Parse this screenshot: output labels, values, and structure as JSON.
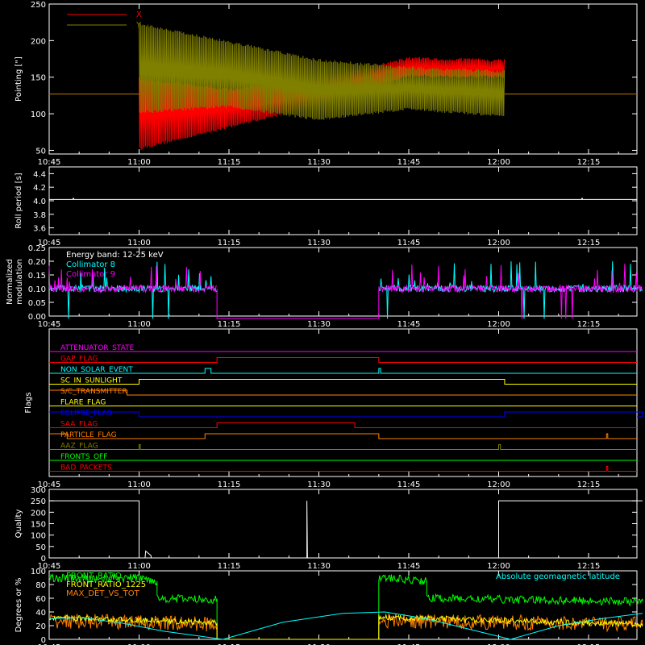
{
  "time_ticks": [
    "10:45",
    "11:00",
    "11:15",
    "11:30",
    "11:45",
    "12:00",
    "12:15"
  ],
  "colors": {
    "x": "#ff0000",
    "y": "#808000",
    "white": "#ffffff",
    "cyan": "#00ffff",
    "magenta": "#ff00ff",
    "green": "#00ff00",
    "orange": "#ff8000"
  },
  "chart_data": [
    {
      "type": "line",
      "ylabel": "Pointing [\"]",
      "ylim": [
        45,
        250
      ],
      "yticks": [
        "50",
        "100",
        "150",
        "200",
        "250"
      ],
      "legend": [
        "X",
        "Y"
      ],
      "series": [
        {
          "name": "X",
          "color": "#ff0000",
          "baseline": 127,
          "active_start": "11:00",
          "active_end": "12:01",
          "envelope_time": [
            "11:00",
            "11:15",
            "11:30",
            "11:45",
            "12:00"
          ],
          "envelope_low": [
            50,
            80,
            110,
            150,
            148
          ],
          "envelope_high": [
            150,
            135,
            150,
            178,
            175
          ]
        },
        {
          "name": "Y",
          "color": "#808000",
          "baseline": 127,
          "active_start": "11:00",
          "active_end": "12:01",
          "envelope_time": [
            "11:00",
            "11:15",
            "11:30",
            "11:45",
            "12:00"
          ],
          "envelope_low": [
            100,
            108,
            90,
            105,
            95
          ],
          "envelope_high": [
            225,
            200,
            175,
            165,
            160
          ]
        }
      ]
    },
    {
      "type": "line",
      "ylabel": "Roll period [s]",
      "ylim": [
        3.5,
        4.5
      ],
      "yticks": [
        "3.6",
        "3.8",
        "4.0",
        "4.2",
        "4.4"
      ],
      "series": [
        {
          "color": "#ffffff",
          "value": 4.02
        }
      ]
    },
    {
      "type": "line",
      "ylabel": "Normalized modulation",
      "ylim": [
        0,
        0.25
      ],
      "yticks": [
        "0.00",
        "0.05",
        "0.10",
        "0.15",
        "0.20",
        "0.25"
      ],
      "legend": [
        "Energy band: 12-25 keV",
        "Collimator 8",
        "Collimator 9"
      ],
      "series": [
        {
          "name": "Collimator 8",
          "color": "#00ffff",
          "segments": [
            [
              "10:45",
              "11:13"
            ],
            [
              "11:40",
              "12:24"
            ]
          ],
          "mean": 0.1
        },
        {
          "name": "Collimator 9",
          "color": "#ff00ff",
          "segments": [
            [
              "10:45",
              "11:13"
            ],
            [
              "11:40",
              "12:24"
            ]
          ],
          "mean": 0.1,
          "gap_value": -0.01
        }
      ]
    },
    {
      "type": "line",
      "ylabel": "Flags",
      "flags": [
        {
          "name": "ATTENUATOR_STATE",
          "color": "#ff00ff",
          "highs": []
        },
        {
          "name": "GAP_FLAG",
          "color": "#ff0000",
          "highs": [
            [
              "11:13",
              "11:40"
            ]
          ]
        },
        {
          "name": "NON_SOLAR_EVENT",
          "color": "#00ffff",
          "highs": [
            [
              "11:11",
              "11:12"
            ],
            [
              "11:40",
              "11:40.3"
            ]
          ]
        },
        {
          "name": "SC_IN_SUNLIGHT",
          "color": "#ffff00",
          "highs": [
            [
              "11:00",
              "12:01"
            ]
          ]
        },
        {
          "name": "S/C_TRANSMITTER",
          "color": "#ff8000",
          "highs": [
            [
              "10:45",
              "10:58"
            ]
          ]
        },
        {
          "name": "FLARE_FLAG",
          "color": "#ffff00",
          "highs": []
        },
        {
          "name": "ECLIPSE_FLAG",
          "color": "#0000ff",
          "highs": [
            [
              "10:45",
              "11:00"
            ],
            [
              "12:01",
              "12:24"
            ]
          ]
        },
        {
          "name": "SAA_FLAG",
          "color": "#ff0000",
          "highs": [
            [
              "11:13",
              "11:36"
            ]
          ]
        },
        {
          "name": "PARTICLE_FLAG",
          "color": "#ff8000",
          "highs": [
            [
              "10:45",
              "10:48"
            ],
            [
              "11:11",
              "11:40"
            ],
            [
              "12:18",
              "12:18.2"
            ]
          ]
        },
        {
          "name": "AAZ_FLAG",
          "color": "#808000",
          "highs": [
            [
              "11:00",
              "11:00.2"
            ],
            [
              "12:00",
              "12:00.3"
            ]
          ]
        },
        {
          "name": "FRONTS_OFF",
          "color": "#00ff00",
          "highs": []
        },
        {
          "name": "BAD_PACKETS",
          "color": "#ff0000",
          "highs": [
            [
              "12:18",
              "12:18.2"
            ]
          ]
        }
      ]
    },
    {
      "type": "line",
      "ylabel": "Quality",
      "ylim": [
        0,
        300
      ],
      "yticks": [
        "0",
        "50",
        "100",
        "150",
        "200",
        "250",
        "300"
      ],
      "series": [
        {
          "color": "#ffffff",
          "points": [
            [
              "10:45",
              250
            ],
            [
              "11:00",
              250
            ],
            [
              "11:00",
              0
            ],
            [
              "11:01",
              0
            ],
            [
              "11:01.1",
              30
            ],
            [
              "11:02",
              10
            ],
            [
              "11:02",
              0
            ],
            [
              "11:28",
              0
            ],
            [
              "11:28",
              250
            ],
            [
              "11:28.1",
              0
            ],
            [
              "12:00",
              0
            ],
            [
              "12:00",
              250
            ],
            [
              "12:24",
              250
            ]
          ]
        }
      ]
    },
    {
      "type": "line",
      "ylabel": "Degrees or %",
      "ylim": [
        0,
        100
      ],
      "yticks": [
        "0",
        "20",
        "40",
        "60",
        "80",
        "100"
      ],
      "legend": [
        "FRONT_RATIO",
        "FRONT_RATIO_1225",
        "MAX_DET_VS_TOT",
        "Absolute geomagnetic latitude"
      ],
      "series": [
        {
          "name": "FRONT_RATIO",
          "color": "#00ff00",
          "points": [
            [
              "10:45",
              90
            ],
            [
              "10:52",
              88
            ],
            [
              "11:00",
              90
            ],
            [
              "11:03",
              85
            ],
            [
              "11:03",
              60
            ],
            [
              "11:13",
              58
            ],
            [
              "11:13",
              0
            ],
            [
              "11:40",
              0
            ],
            [
              "11:40",
              90
            ],
            [
              "11:48",
              85
            ],
            [
              "11:48",
              60
            ],
            [
              "12:24",
              55
            ]
          ]
        },
        {
          "name": "MAX_DET_VS_TOT",
          "color": "#ff8000",
          "points": [
            [
              "10:45",
              25
            ],
            [
              "11:13",
              20
            ],
            [
              "11:13",
              0
            ],
            [
              "11:40",
              0
            ],
            [
              "11:40",
              25
            ],
            [
              "12:24",
              20
            ]
          ]
        },
        {
          "name": "FRONT_RATIO_1225",
          "color": "#ffff00",
          "points": [
            [
              "10:45",
              32
            ],
            [
              "11:00",
              28
            ],
            [
              "11:13",
              24
            ],
            [
              "11:13",
              0
            ],
            [
              "11:40",
              0
            ],
            [
              "11:40",
              32
            ],
            [
              "12:24",
              22
            ]
          ]
        },
        {
          "name": "Absolute geomagnetic latitude",
          "color": "#00ffff",
          "points": [
            [
              "10:45",
              30
            ],
            [
              "10:50",
              32
            ],
            [
              "10:57",
              24
            ],
            [
              "11:04",
              12
            ],
            [
              "11:14",
              0
            ],
            [
              "11:24",
              25
            ],
            [
              "11:34",
              38
            ],
            [
              "11:41",
              40
            ],
            [
              "11:48",
              30
            ],
            [
              "11:55",
              15
            ],
            [
              "12:02",
              0
            ],
            [
              "12:10",
              20
            ],
            [
              "12:17",
              30
            ],
            [
              "12:24",
              38
            ]
          ]
        }
      ]
    }
  ]
}
